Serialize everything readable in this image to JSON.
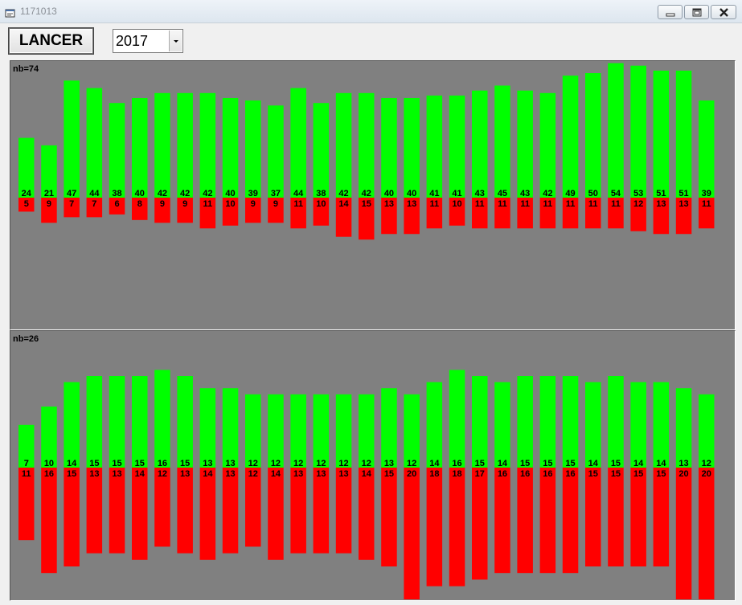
{
  "window": {
    "title": "1171013"
  },
  "toolbar": {
    "lancer_label": "LANCER",
    "year": "2017"
  },
  "colors": {
    "green": "#00ff00",
    "red": "#ff0000",
    "panel_bg": "#808080"
  },
  "panels": [
    {
      "label": "nb=74",
      "chart_data": {
        "type": "bar",
        "series": [
          {
            "name": "",
            "color": "#00ff00",
            "values": [
              24,
              21,
              47,
              44,
              38,
              40,
              42,
              42,
              42,
              40,
              39,
              37,
              44,
              38,
              42,
              42,
              40,
              40,
              41,
              41,
              43,
              45,
              43,
              42,
              49,
              50,
              54,
              53,
              51,
              51,
              39
            ]
          },
          {
            "name": "",
            "color": "#ff0000",
            "values": [
              5,
              9,
              7,
              7,
              6,
              8,
              9,
              9,
              11,
              10,
              9,
              9,
              11,
              10,
              14,
              15,
              13,
              13,
              11,
              10,
              11,
              11,
              11,
              11,
              11,
              11,
              11,
              12,
              13,
              13,
              11
            ]
          }
        ]
      }
    },
    {
      "label": "nb=26",
      "chart_data": {
        "type": "bar",
        "series": [
          {
            "name": "",
            "color": "#00ff00",
            "values": [
              7,
              10,
              14,
              15,
              15,
              15,
              16,
              15,
              13,
              13,
              12,
              12,
              12,
              12,
              12,
              12,
              13,
              12,
              14,
              16,
              15,
              14,
              15,
              15,
              15,
              14,
              15,
              14,
              14,
              13,
              12
            ]
          },
          {
            "name": "",
            "color": "#ff0000",
            "values": [
              11,
              16,
              15,
              13,
              13,
              14,
              12,
              13,
              14,
              13,
              12,
              14,
              13,
              13,
              13,
              14,
              15,
              20,
              18,
              18,
              17,
              16,
              16,
              16,
              16,
              15,
              15,
              15,
              15,
              20,
              20
            ]
          }
        ]
      }
    }
  ]
}
